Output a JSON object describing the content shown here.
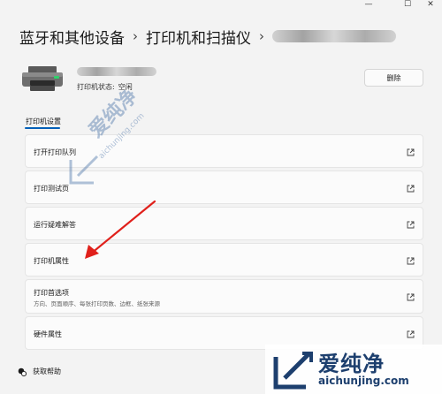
{
  "window": {
    "minimize_icon": "minimize-icon",
    "maximize_icon": "maximize-icon",
    "close_icon": "close-icon"
  },
  "breadcrumb": {
    "items": [
      "蓝牙和其他设备",
      "打印机和扫描仪"
    ],
    "separator": "›"
  },
  "device": {
    "status_label": "打印机状态:",
    "status_value": "空闲",
    "remove_label": "删除",
    "icon": "printer-icon"
  },
  "section": {
    "title": "打印机设置"
  },
  "settings": [
    {
      "label": "打开打印队列",
      "description": "",
      "icon": "open-external-icon"
    },
    {
      "label": "打印测试页",
      "description": "",
      "icon": "open-external-icon"
    },
    {
      "label": "运行疑难解答",
      "description": "",
      "icon": "open-external-icon"
    },
    {
      "label": "打印机属性",
      "description": "",
      "icon": "open-external-icon"
    },
    {
      "label": "打印首选项",
      "description": "方向、页面顺序、每张打印页数、边框、纸张来源",
      "icon": "open-external-icon"
    },
    {
      "label": "硬件属性",
      "description": "",
      "icon": "open-external-icon"
    }
  ],
  "help": {
    "label": "获取帮助",
    "icon": "help-icon"
  },
  "annotation": {
    "color": "#e0201b"
  },
  "watermark": {
    "brand_cn": "爱纯净",
    "brand_en": "aichunjing.com",
    "color": "#1d3f6e"
  },
  "colors": {
    "accent": "#005fb8",
    "background": "#f3f3f3",
    "card": "#fbfbfb"
  }
}
